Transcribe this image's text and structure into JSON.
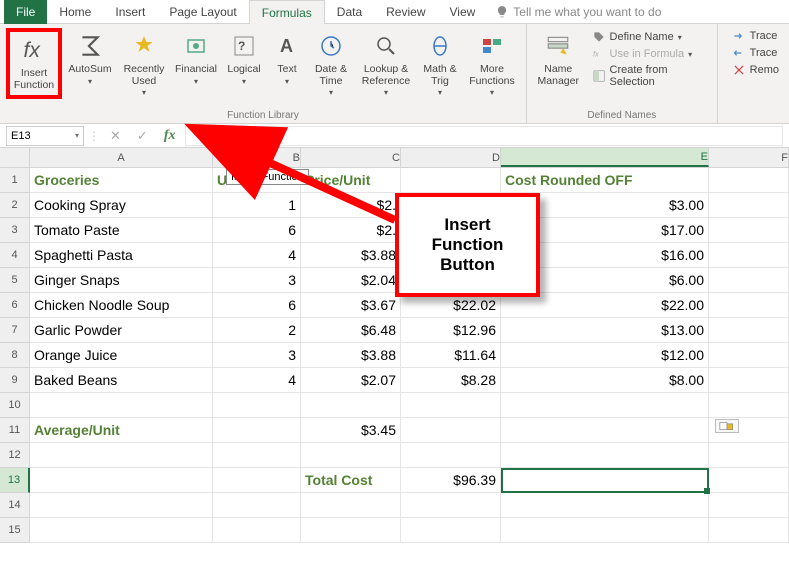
{
  "tabs": {
    "file": "File",
    "home": "Home",
    "insert": "Insert",
    "pagelayout": "Page Layout",
    "formulas": "Formulas",
    "data": "Data",
    "review": "Review",
    "view": "View",
    "tellme": "Tell me what you want to do"
  },
  "ribbon": {
    "insert_function_top": "Insert",
    "insert_function_bottom": "Function",
    "autosum": "AutoSum",
    "recently": "Recently Used",
    "financial": "Financial",
    "logical": "Logical",
    "text": "Text",
    "datetime": "Date & Time",
    "lookup": "Lookup & Reference",
    "math": "Math & Trig",
    "more": "More Functions",
    "group_library": "Function Library",
    "name_manager": "Name Manager",
    "define_name": "Define Name",
    "use_in_formula": "Use in Formula",
    "create_selection": "Create from Selection",
    "group_defined": "Defined Names",
    "trace1": "Trace",
    "trace2": "Trace",
    "remo": "Remo"
  },
  "namebox": "E13",
  "tooltip": "Insert Function",
  "callout": {
    "l1": "Insert Function",
    "l2": "Button"
  },
  "headers": {
    "A": "Groceries",
    "B": "Units",
    "C": "Price/Unit",
    "D": "",
    "E": "Cost Rounded OFF"
  },
  "data_rows": [
    {
      "a": "Cooking Spray",
      "b": "1",
      "c": "$2.",
      "d": "",
      "e": "$3.00"
    },
    {
      "a": "Tomato Paste",
      "b": "6",
      "c": "$2.",
      "d": "",
      "e": "$17.00"
    },
    {
      "a": "Spaghetti Pasta",
      "b": "4",
      "c": "$3.88",
      "d": "$15.52",
      "e": "$16.00"
    },
    {
      "a": "Ginger Snaps",
      "b": "3",
      "c": "$2.04",
      "d": "$6.12",
      "e": "$6.00"
    },
    {
      "a": "Chicken Noodle Soup",
      "b": "6",
      "c": "$3.67",
      "d": "$22.02",
      "e": "$22.00"
    },
    {
      "a": "Garlic Powder",
      "b": "2",
      "c": "$6.48",
      "d": "$12.96",
      "e": "$13.00"
    },
    {
      "a": "Orange Juice",
      "b": "3",
      "c": "$3.88",
      "d": "$11.64",
      "e": "$12.00"
    },
    {
      "a": "Baked Beans",
      "b": "4",
      "c": "$2.07",
      "d": "$8.28",
      "e": "$8.00"
    }
  ],
  "avg_label": "Average/Unit",
  "avg_val": "$3.45",
  "total_label": "Total Cost",
  "total_val": "$96.39"
}
